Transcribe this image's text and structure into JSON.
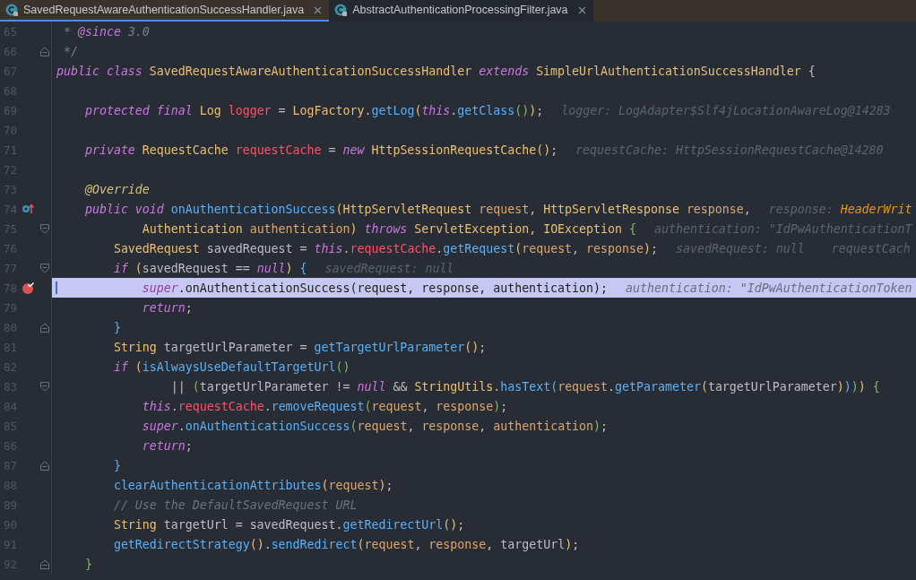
{
  "tabs": [
    {
      "label": "SavedRequestAwareAuthenticationSuccessHandler.java",
      "selected": true
    },
    {
      "label": "AbstractAuthenticationProcessingFilter.java",
      "selected": false
    }
  ],
  "editor": {
    "lines": [
      {
        "number": "65",
        "current": false,
        "fold_start": false,
        "fold_end": false,
        "breakpoint": false,
        "override": false,
        "tokens": [
          {
            "kind": "d",
            "text": " * "
          },
          {
            "kind": "dt",
            "text": "@since"
          },
          {
            "kind": "d",
            "text": " 3.0"
          }
        ]
      },
      {
        "number": "66",
        "current": false,
        "fold_start": false,
        "fold_end": true,
        "breakpoint": false,
        "override": false,
        "tokens": [
          {
            "kind": "d",
            "text": " */"
          }
        ]
      },
      {
        "number": "67",
        "current": false,
        "fold_start": false,
        "fold_end": false,
        "breakpoint": false,
        "override": false,
        "tokens": [
          {
            "kind": "kw",
            "text": "public class "
          },
          {
            "kind": "ty",
            "text": "SavedRequestAwareAuthenticationSuccessHandler "
          },
          {
            "kind": "kw",
            "text": "extends "
          },
          {
            "kind": "ty",
            "text": "SimpleUrlAuthenticationSuccessHandler"
          },
          {
            "kind": "p",
            "text": " {"
          }
        ]
      },
      {
        "number": "68",
        "current": false,
        "fold_start": false,
        "fold_end": false,
        "breakpoint": false,
        "override": false
      },
      {
        "number": "69",
        "current": false,
        "fold_start": false,
        "fold_end": false,
        "breakpoint": false,
        "override": false,
        "tokens": [
          {
            "kind": "kw",
            "text": "    protected final "
          },
          {
            "kind": "ty",
            "text": "Log "
          },
          {
            "kind": "f",
            "text": "logger"
          },
          {
            "kind": "p",
            "text": " = "
          },
          {
            "kind": "ty",
            "text": "LogFactory"
          },
          {
            "kind": "p",
            "text": "."
          },
          {
            "kind": "m",
            "text": "getLog"
          },
          {
            "kind": "b1",
            "text": "("
          },
          {
            "kind": "kw",
            "text": "this"
          },
          {
            "kind": "p",
            "text": "."
          },
          {
            "kind": "m",
            "text": "getClass"
          },
          {
            "kind": "b2",
            "text": "()"
          },
          {
            "kind": "b1",
            "text": ")"
          },
          {
            "kind": "p",
            "text": ";"
          }
        ],
        "hints": [
          {
            "parts": [
              {
                "kind": "h",
                "text": "logger: LogAdapter$Slf4jLocationAwareLog@14283"
              }
            ]
          }
        ]
      },
      {
        "number": "70",
        "current": false,
        "fold_start": false,
        "fold_end": false,
        "breakpoint": false,
        "override": false
      },
      {
        "number": "71",
        "current": false,
        "fold_start": false,
        "fold_end": false,
        "breakpoint": false,
        "override": false,
        "tokens": [
          {
            "kind": "kw",
            "text": "    private "
          },
          {
            "kind": "ty",
            "text": "RequestCache "
          },
          {
            "kind": "f",
            "text": "requestCache"
          },
          {
            "kind": "p",
            "text": " = "
          },
          {
            "kind": "kw",
            "text": "new "
          },
          {
            "kind": "ty",
            "text": "HttpSessionRequestCache"
          },
          {
            "kind": "b1",
            "text": "()"
          },
          {
            "kind": "p",
            "text": ";"
          }
        ],
        "hints": [
          {
            "parts": [
              {
                "kind": "h",
                "text": "requestCache: HttpSessionRequestCache@14280"
              }
            ]
          }
        ]
      },
      {
        "number": "72",
        "current": false,
        "fold_start": false,
        "fold_end": false,
        "breakpoint": false,
        "override": false
      },
      {
        "number": "73",
        "current": false,
        "fold_start": false,
        "fold_end": false,
        "breakpoint": false,
        "override": false,
        "tokens": [
          {
            "kind": "a",
            "text": "    @Override"
          }
        ]
      },
      {
        "number": "74",
        "current": false,
        "fold_start": false,
        "fold_end": false,
        "breakpoint": false,
        "override": true,
        "tokens": [
          {
            "kind": "kw",
            "text": "    public void "
          },
          {
            "kind": "m",
            "text": "onAuthenticationSuccess"
          },
          {
            "kind": "b1",
            "text": "("
          },
          {
            "kind": "ty",
            "text": "HttpServletRequest "
          },
          {
            "kind": "v",
            "text": "request"
          },
          {
            "kind": "p",
            "text": ", "
          },
          {
            "kind": "ty",
            "text": "HttpServletResponse "
          },
          {
            "kind": "v",
            "text": "response"
          },
          {
            "kind": "p",
            "text": ","
          }
        ],
        "hints": [
          {
            "parts": [
              {
                "kind": "h",
                "text": "response: "
              },
              {
                "kind": "hv",
                "text": "HeaderWrit"
              }
            ]
          }
        ]
      },
      {
        "number": "75",
        "current": false,
        "fold_start": true,
        "fold_end": false,
        "breakpoint": false,
        "override": false,
        "tokens": [
          {
            "kind": "ty",
            "text": "            Authentication "
          },
          {
            "kind": "v",
            "text": "authentication"
          },
          {
            "kind": "b1",
            "text": ")"
          },
          {
            "kind": "kw",
            "text": " throws "
          },
          {
            "kind": "ty",
            "text": "ServletException"
          },
          {
            "kind": "p",
            "text": ", "
          },
          {
            "kind": "ty",
            "text": "IOException "
          },
          {
            "kind": "b2",
            "text": "{"
          }
        ],
        "hints": [
          {
            "parts": [
              {
                "kind": "h",
                "text": "authentication: \"IdPwAuthenticationT"
              }
            ]
          }
        ]
      },
      {
        "number": "76",
        "current": false,
        "fold_start": false,
        "fold_end": false,
        "breakpoint": false,
        "override": false,
        "tokens": [
          {
            "kind": "ty",
            "text": "        SavedRequest"
          },
          {
            "kind": "p",
            "text": " savedRequest = "
          },
          {
            "kind": "kw",
            "text": "this"
          },
          {
            "kind": "p",
            "text": "."
          },
          {
            "kind": "f",
            "text": "requestCache"
          },
          {
            "kind": "p",
            "text": "."
          },
          {
            "kind": "m",
            "text": "getRequest"
          },
          {
            "kind": "b1",
            "text": "("
          },
          {
            "kind": "v",
            "text": "request"
          },
          {
            "kind": "p",
            "text": ", "
          },
          {
            "kind": "v",
            "text": "response"
          },
          {
            "kind": "b1",
            "text": ")"
          },
          {
            "kind": "p",
            "text": ";"
          }
        ],
        "hints": [
          {
            "parts": [
              {
                "kind": "h",
                "text": "savedRequest: null"
              }
            ]
          },
          {
            "parts": [
              {
                "kind": "h",
                "text": "requestCach"
              }
            ]
          }
        ]
      },
      {
        "number": "77",
        "current": false,
        "fold_start": true,
        "fold_end": false,
        "breakpoint": false,
        "override": false,
        "tokens": [
          {
            "kind": "kw",
            "text": "        if "
          },
          {
            "kind": "b1",
            "text": "("
          },
          {
            "kind": "p",
            "text": "savedRequest == "
          },
          {
            "kind": "kw",
            "text": "null"
          },
          {
            "kind": "b1",
            "text": ")"
          },
          {
            "kind": "b3",
            "text": " {"
          }
        ],
        "hints": [
          {
            "parts": [
              {
                "kind": "h",
                "text": "savedRequest: null"
              }
            ]
          }
        ]
      },
      {
        "number": "78",
        "current": true,
        "fold_start": false,
        "fold_end": false,
        "breakpoint": true,
        "override": false,
        "tokens": [
          {
            "kind": "kw",
            "text": "            super"
          },
          {
            "kind": "p",
            "text": ".onAuthenticationSuccess(request, response, authentication);"
          }
        ],
        "hints": [
          {
            "parts": [
              {
                "kind": "h",
                "text": "authentication: \"IdPwAuthenticationToken"
              }
            ]
          }
        ]
      },
      {
        "number": "79",
        "current": false,
        "fold_start": false,
        "fold_end": false,
        "breakpoint": false,
        "override": false,
        "tokens": [
          {
            "kind": "kw",
            "text": "            return"
          },
          {
            "kind": "p",
            "text": ";"
          }
        ]
      },
      {
        "number": "80",
        "current": false,
        "fold_start": false,
        "fold_end": true,
        "breakpoint": false,
        "override": false,
        "tokens": [
          {
            "kind": "b3",
            "text": "        }"
          }
        ]
      },
      {
        "number": "81",
        "current": false,
        "fold_start": false,
        "fold_end": false,
        "breakpoint": false,
        "override": false,
        "tokens": [
          {
            "kind": "ty",
            "text": "        String"
          },
          {
            "kind": "p",
            "text": " targetUrlParameter = "
          },
          {
            "kind": "m",
            "text": "getTargetUrlParameter"
          },
          {
            "kind": "b1",
            "text": "()"
          },
          {
            "kind": "p",
            "text": ";"
          }
        ]
      },
      {
        "number": "82",
        "current": false,
        "fold_start": false,
        "fold_end": false,
        "breakpoint": false,
        "override": false,
        "tokens": [
          {
            "kind": "kw",
            "text": "        if "
          },
          {
            "kind": "b1",
            "text": "("
          },
          {
            "kind": "m",
            "text": "isAlwaysUseDefaultTargetUrl"
          },
          {
            "kind": "b2",
            "text": "()"
          }
        ]
      },
      {
        "number": "83",
        "current": false,
        "fold_start": true,
        "fold_end": false,
        "breakpoint": false,
        "override": false,
        "tokens": [
          {
            "kind": "p",
            "text": "                || "
          },
          {
            "kind": "b2",
            "text": "("
          },
          {
            "kind": "p",
            "text": "targetUrlParameter != "
          },
          {
            "kind": "kw",
            "text": "null"
          },
          {
            "kind": "p",
            "text": " && "
          },
          {
            "kind": "ty",
            "text": "StringUtils"
          },
          {
            "kind": "p",
            "text": "."
          },
          {
            "kind": "m",
            "text": "hasText"
          },
          {
            "kind": "b3",
            "text": "("
          },
          {
            "kind": "v",
            "text": "request"
          },
          {
            "kind": "p",
            "text": "."
          },
          {
            "kind": "m",
            "text": "getParameter"
          },
          {
            "kind": "b1",
            "text": "("
          },
          {
            "kind": "p",
            "text": "targetUrlParameter"
          },
          {
            "kind": "b1",
            "text": ")"
          },
          {
            "kind": "b3",
            "text": ")"
          },
          {
            "kind": "b2",
            "text": ")"
          },
          {
            "kind": "b1",
            "text": ")"
          },
          {
            "kind": "b2",
            "text": " {"
          }
        ]
      },
      {
        "number": "84",
        "current": false,
        "fold_start": false,
        "fold_end": false,
        "breakpoint": false,
        "override": false,
        "tokens": [
          {
            "kind": "kw",
            "text": "            this"
          },
          {
            "kind": "p",
            "text": "."
          },
          {
            "kind": "f",
            "text": "requestCache"
          },
          {
            "kind": "p",
            "text": "."
          },
          {
            "kind": "m",
            "text": "removeRequest"
          },
          {
            "kind": "b2",
            "text": "("
          },
          {
            "kind": "v",
            "text": "request"
          },
          {
            "kind": "p",
            "text": ", "
          },
          {
            "kind": "v",
            "text": "response"
          },
          {
            "kind": "b2",
            "text": ")"
          },
          {
            "kind": "p",
            "text": ";"
          }
        ]
      },
      {
        "number": "85",
        "current": false,
        "fold_start": false,
        "fold_end": false,
        "breakpoint": false,
        "override": false,
        "tokens": [
          {
            "kind": "kw",
            "text": "            super"
          },
          {
            "kind": "p",
            "text": "."
          },
          {
            "kind": "m",
            "text": "onAuthenticationSuccess"
          },
          {
            "kind": "b2",
            "text": "("
          },
          {
            "kind": "v",
            "text": "request"
          },
          {
            "kind": "p",
            "text": ", "
          },
          {
            "kind": "v",
            "text": "response"
          },
          {
            "kind": "p",
            "text": ", "
          },
          {
            "kind": "v",
            "text": "authentication"
          },
          {
            "kind": "b2",
            "text": ")"
          },
          {
            "kind": "p",
            "text": ";"
          }
        ]
      },
      {
        "number": "86",
        "current": false,
        "fold_start": false,
        "fold_end": false,
        "breakpoint": false,
        "override": false,
        "tokens": [
          {
            "kind": "kw",
            "text": "            return"
          },
          {
            "kind": "p",
            "text": ";"
          }
        ]
      },
      {
        "number": "87",
        "current": false,
        "fold_start": false,
        "fold_end": true,
        "breakpoint": false,
        "override": false,
        "tokens": [
          {
            "kind": "b3",
            "text": "        }"
          }
        ]
      },
      {
        "number": "88",
        "current": false,
        "fold_start": false,
        "fold_end": false,
        "breakpoint": false,
        "override": false,
        "tokens": [
          {
            "kind": "m",
            "text": "        clearAuthenticationAttributes"
          },
          {
            "kind": "b1",
            "text": "("
          },
          {
            "kind": "v",
            "text": "request"
          },
          {
            "kind": "b1",
            "text": ")"
          },
          {
            "kind": "p",
            "text": ";"
          }
        ]
      },
      {
        "number": "89",
        "current": false,
        "fold_start": false,
        "fold_end": false,
        "breakpoint": false,
        "override": false,
        "tokens": [
          {
            "kind": "c",
            "text": "        // Use the DefaultSavedRequest URL"
          }
        ]
      },
      {
        "number": "90",
        "current": false,
        "fold_start": false,
        "fold_end": false,
        "breakpoint": false,
        "override": false,
        "tokens": [
          {
            "kind": "ty",
            "text": "        String"
          },
          {
            "kind": "p",
            "text": " targetUrl = savedRequest."
          },
          {
            "kind": "m",
            "text": "getRedirectUrl"
          },
          {
            "kind": "b1",
            "text": "()"
          },
          {
            "kind": "p",
            "text": ";"
          }
        ]
      },
      {
        "number": "91",
        "current": false,
        "fold_start": false,
        "fold_end": false,
        "breakpoint": false,
        "override": false,
        "tokens": [
          {
            "kind": "m",
            "text": "        getRedirectStrategy"
          },
          {
            "kind": "b1",
            "text": "()"
          },
          {
            "kind": "p",
            "text": "."
          },
          {
            "kind": "m",
            "text": "sendRedirect"
          },
          {
            "kind": "b1",
            "text": "("
          },
          {
            "kind": "v",
            "text": "request"
          },
          {
            "kind": "p",
            "text": ", "
          },
          {
            "kind": "v",
            "text": "response"
          },
          {
            "kind": "p",
            "text": ", targetUrl"
          },
          {
            "kind": "b1",
            "text": ")"
          },
          {
            "kind": "p",
            "text": ";"
          }
        ]
      },
      {
        "number": "92",
        "current": false,
        "fold_start": false,
        "fold_end": true,
        "breakpoint": false,
        "override": false,
        "tokens": [
          {
            "kind": "b2",
            "text": "    }"
          }
        ]
      }
    ]
  }
}
